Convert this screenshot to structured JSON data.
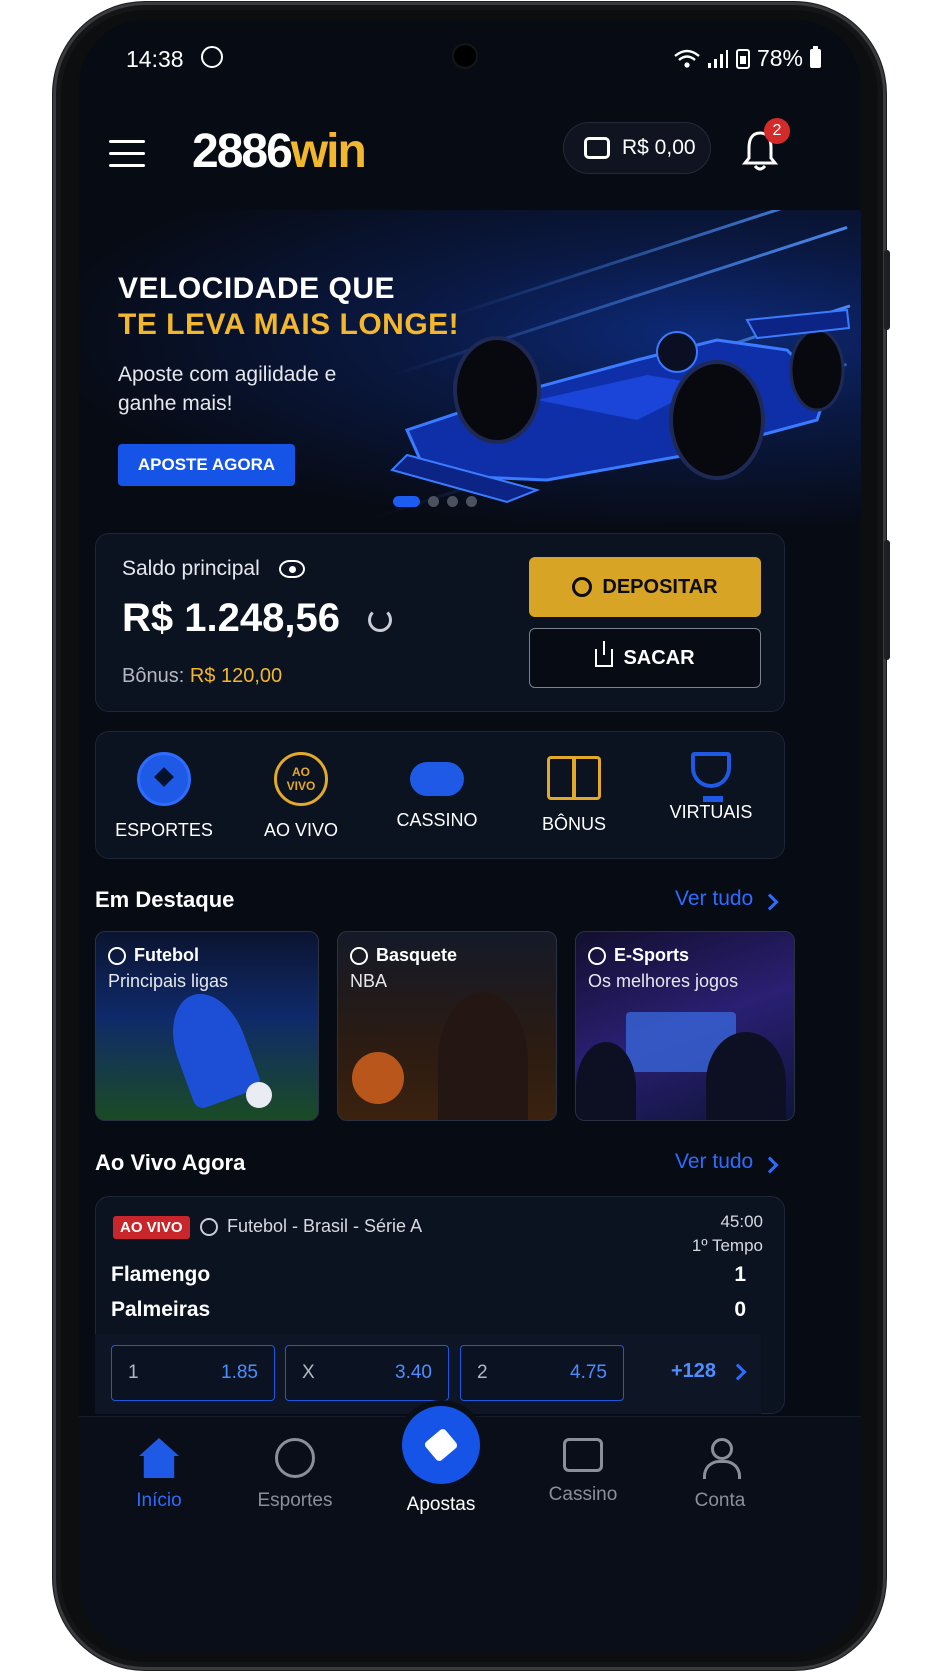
{
  "status_bar": {
    "time": "14:38",
    "battery": "78%"
  },
  "header": {
    "logo_a": "2886",
    "logo_b": "win",
    "wallet_balance": "R$ 0,00",
    "notification_count": "2"
  },
  "hero": {
    "title_line1": "VELOCIDADE QUE",
    "title_line2": "TE LEVA MAIS LONGE!",
    "subtitle": "Aposte com agilidade e ganhe mais!",
    "cta": "APOSTE AGORA",
    "slides": 4,
    "active_slide": 1
  },
  "balance": {
    "label": "Saldo principal",
    "value": "R$ 1.248,56",
    "bonus_label": "Bônus:",
    "bonus_value": "R$ 120,00",
    "deposit": "DEPOSITAR",
    "withdraw": "SACAR"
  },
  "categories": [
    {
      "label": "ESPORTES",
      "icon": "soccer-ball-icon"
    },
    {
      "label": "AO VIVO",
      "icon": "live-badge-icon",
      "badge_text": "AO VIVO"
    },
    {
      "label": "CASSINO",
      "icon": "gamepad-icon"
    },
    {
      "label": "BÔNUS",
      "icon": "gift-icon"
    },
    {
      "label": "VIRTUAIS",
      "icon": "trophy-icon"
    }
  ],
  "featured": {
    "title": "Em Destaque",
    "see_all": "Ver tudo",
    "items": [
      {
        "title": "Futebol",
        "subtitle": "Principais ligas"
      },
      {
        "title": "Basquete",
        "subtitle": "NBA"
      },
      {
        "title": "E-Sports",
        "subtitle": "Os melhores jogos"
      }
    ]
  },
  "live": {
    "title": "Ao Vivo Agora",
    "see_all": "Ver tudo",
    "match": {
      "badge": "AO VIVO",
      "league": "Futebol - Brasil - Série A",
      "clock": "45:00",
      "period": "1º Tempo",
      "home": "Flamengo",
      "home_score": "1",
      "away": "Palmeiras",
      "away_score": "0",
      "odds": [
        {
          "key": "1",
          "value": "1.85"
        },
        {
          "key": "X",
          "value": "3.40"
        },
        {
          "key": "2",
          "value": "4.75"
        }
      ],
      "more_markets": "+128"
    }
  },
  "bottom_nav": {
    "items": [
      {
        "label": "Início",
        "icon": "home-icon",
        "active": true
      },
      {
        "label": "Esportes",
        "icon": "soccer-ball-icon"
      },
      {
        "label": "Apostas",
        "icon": "ticket-icon"
      },
      {
        "label": "Cassino",
        "icon": "slot-machine-icon"
      },
      {
        "label": "Conta",
        "icon": "user-icon"
      }
    ]
  },
  "colors": {
    "accent_blue": "#1554e6",
    "gold": "#f2b72c",
    "live_red": "#c8262b",
    "background": "#070b14"
  }
}
